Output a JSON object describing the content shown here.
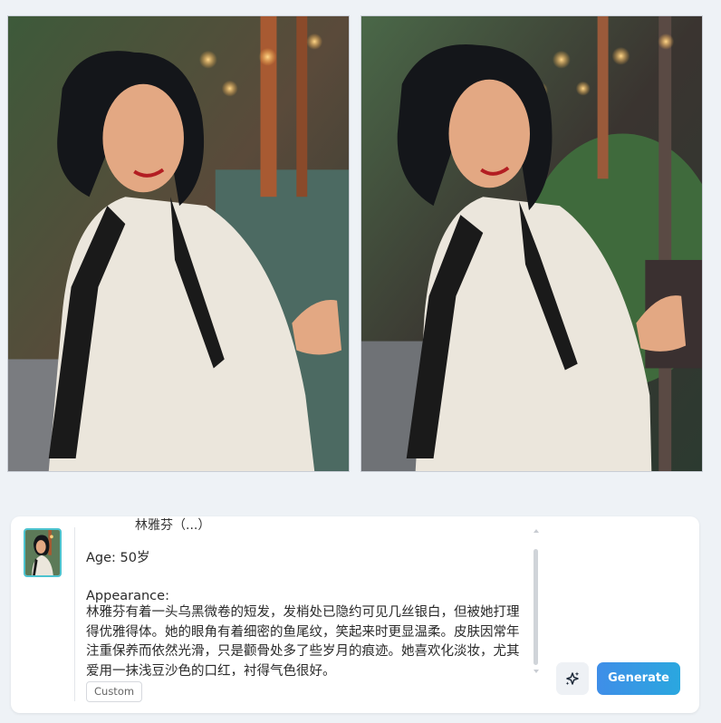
{
  "images": {
    "original_icon": "portrait-photo",
    "generated_icon": "portrait-photo"
  },
  "composer": {
    "cut_off_line": "林雅芬（...）",
    "age": "Age: 50岁",
    "appearance_label": "Appearance:",
    "appearance_text": "林雅芬有着一头乌黑微卷的短发，发梢处已隐约可见几丝银白，但被她打理得优雅得体。她的眼角有着细密的鱼尾纹，笑起来时更显温柔。皮肤因常年注重保养而依然光滑，只是颧骨处多了些岁月的痕迹。她喜欢化淡妆，尤其爱用一抹浅豆沙色的口红，衬得气色很好。",
    "custom_label": "Custom",
    "generate_label": "Generate",
    "magic_icon": "sparkle-icon"
  },
  "colors": {
    "accent_start": "#3f8ee8",
    "accent_end": "#2aa7df",
    "thumb_border": "#4cc3cf"
  }
}
